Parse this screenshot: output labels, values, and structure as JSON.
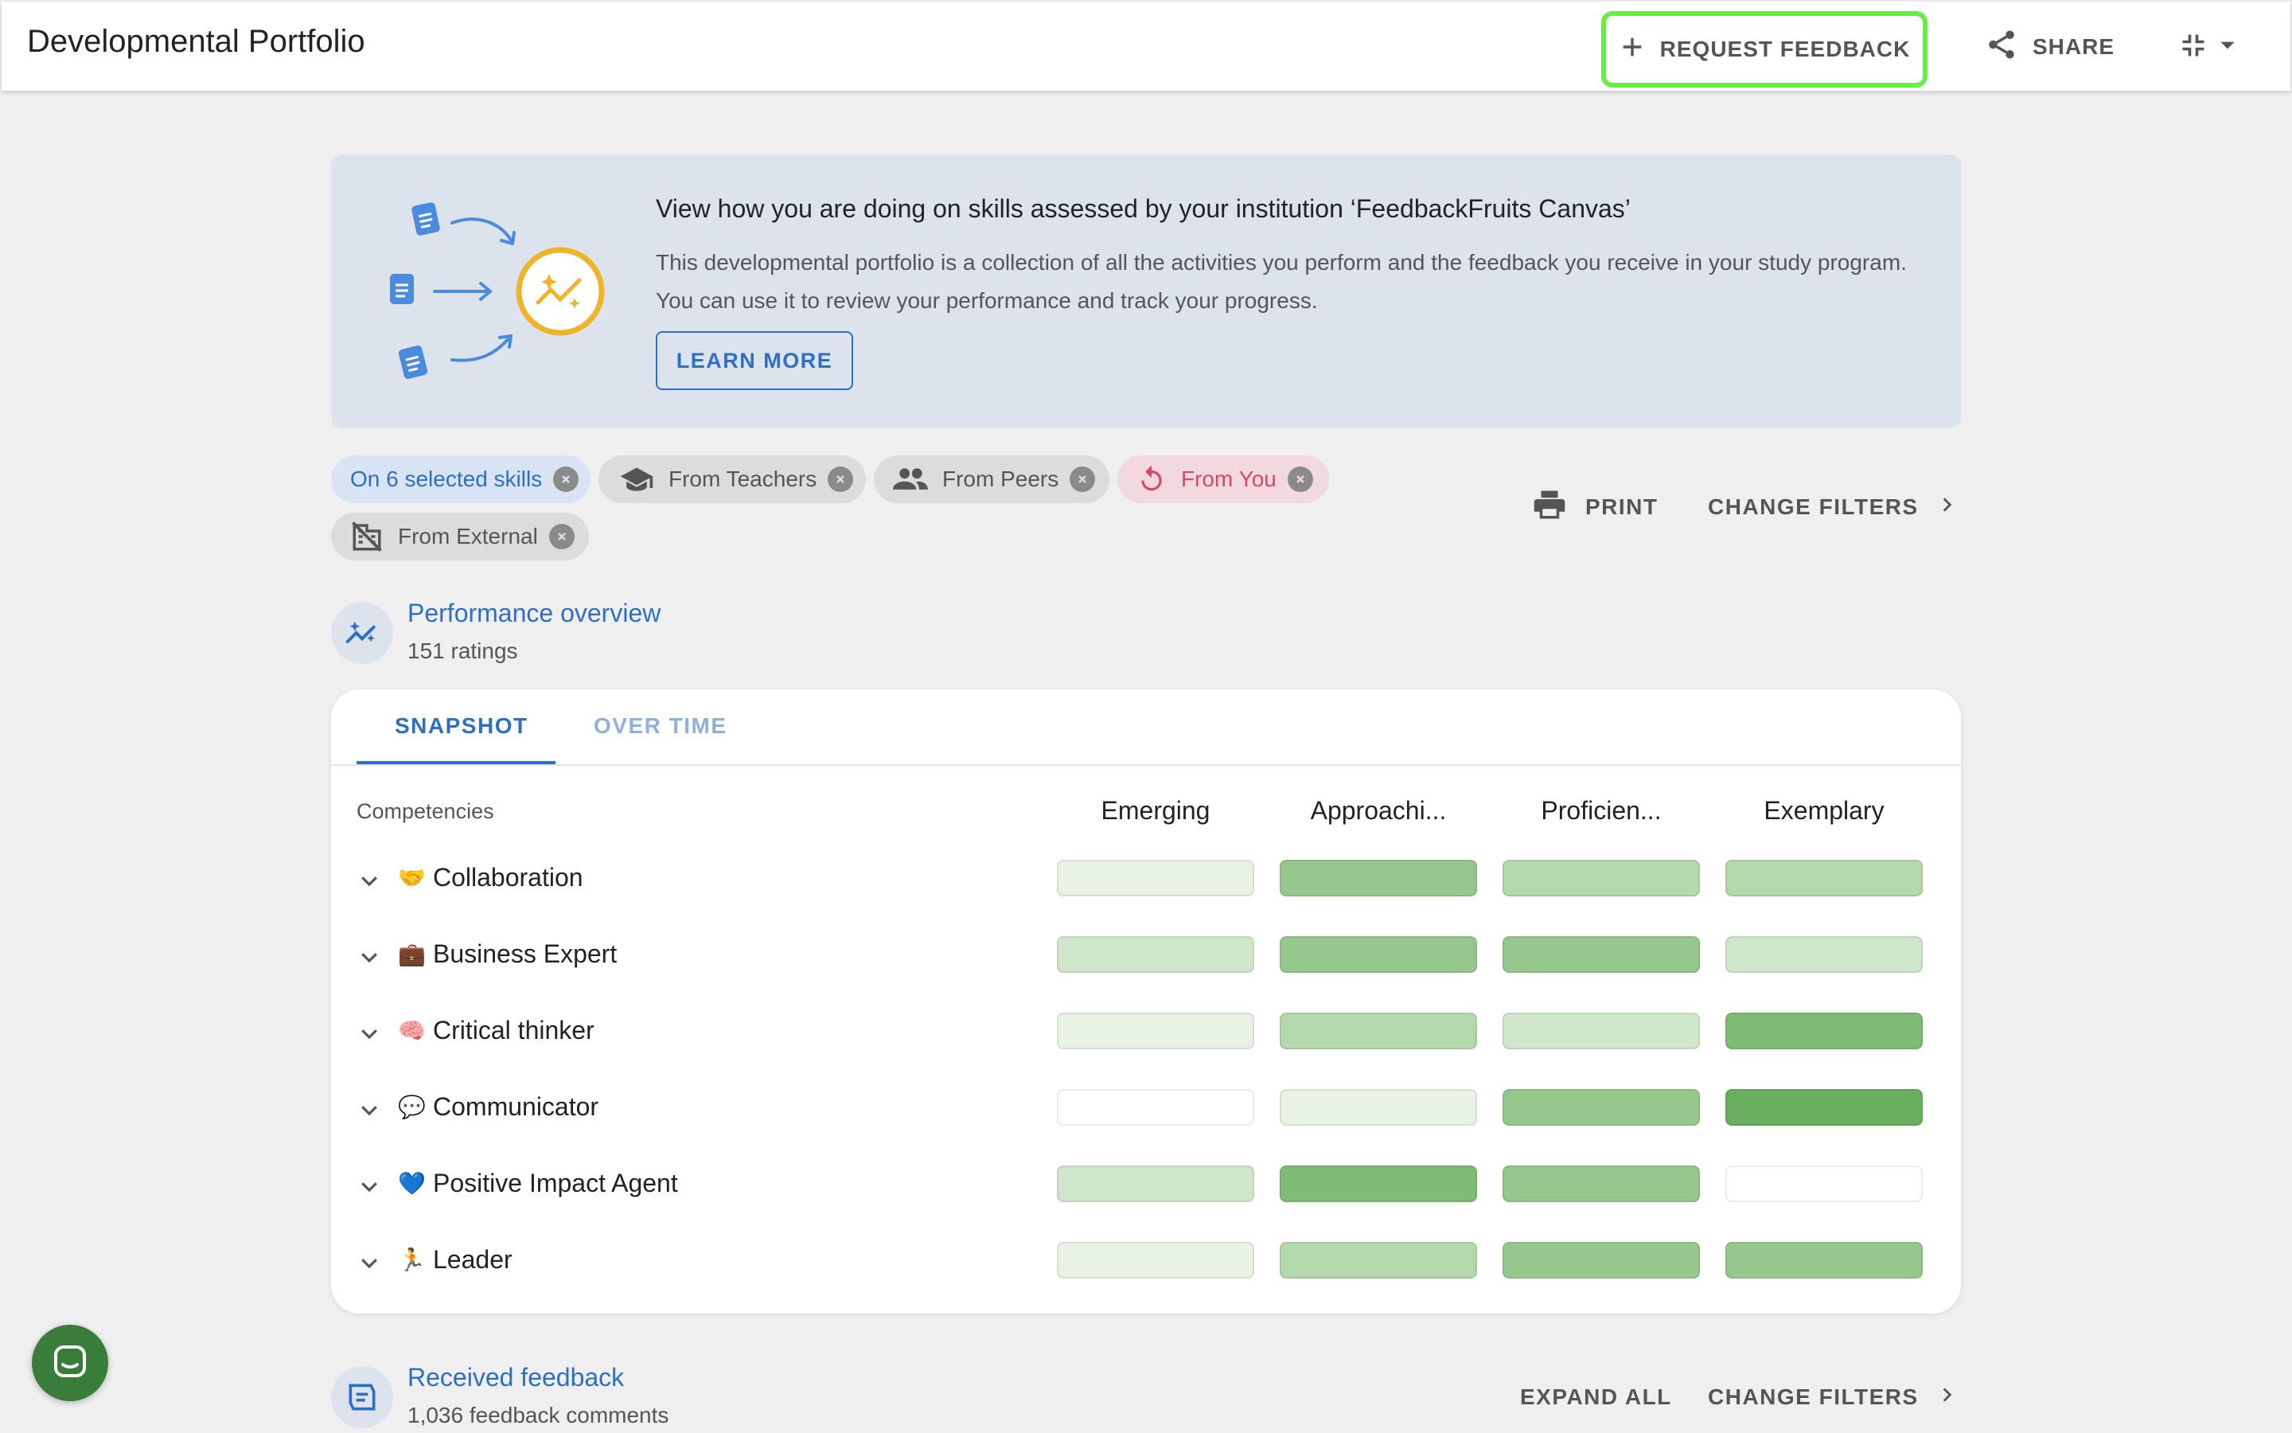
{
  "header": {
    "title": "Developmental Portfolio",
    "request_feedback": "REQUEST FEEDBACK",
    "share": "SHARE"
  },
  "banner": {
    "heading": "View how you are doing on skills assessed by your institution ‘FeedbackFruits Canvas’",
    "text": "This developmental portfolio is a collection of all the activities you perform and the feedback you receive in your study program. You can use it to review your performance and track your progress.",
    "learn_more": "LEARN MORE"
  },
  "filters": {
    "chips": [
      "On 6 selected skills",
      "From Teachers",
      "From Peers",
      "From You",
      "From External"
    ],
    "print": "PRINT",
    "change_filters": "CHANGE FILTERS"
  },
  "performance": {
    "title": "Performance overview",
    "subtitle": "151 ratings",
    "tabs": [
      "SNAPSHOT",
      "OVER TIME"
    ],
    "competencies_label": "Competencies",
    "levels": [
      "Emerging",
      "Approachi...",
      "Proficien...",
      "Exemplary"
    ],
    "rows": [
      {
        "emoji": "🤝",
        "label": "Collaboration",
        "intensity": [
          1,
          4,
          3,
          3
        ]
      },
      {
        "emoji": "💼",
        "label": "Business Expert",
        "intensity": [
          2,
          4,
          4,
          2
        ]
      },
      {
        "emoji": "🧠",
        "label": "Critical thinker",
        "intensity": [
          1,
          3,
          2,
          5
        ]
      },
      {
        "emoji": "💬",
        "label": "Communicator",
        "intensity": [
          0,
          1,
          4,
          6
        ]
      },
      {
        "emoji": "💙",
        "label": "Positive Impact Agent",
        "intensity": [
          2,
          5,
          4,
          0
        ]
      },
      {
        "emoji": "🏃",
        "label": "Leader",
        "intensity": [
          1,
          3,
          4,
          4
        ]
      }
    ],
    "palette": [
      "#ffffff",
      "#e8f3e6",
      "#cfe6cb",
      "#b3d9ad",
      "#96c88e",
      "#7fbd76",
      "#6aaf5f"
    ]
  },
  "received": {
    "title": "Received feedback",
    "subtitle": "1,036 feedback comments",
    "expand_all": "EXPAND ALL",
    "change_filters": "CHANGE FILTERS"
  },
  "icons": [
    "plus-icon",
    "share-icon",
    "collapse-icon",
    "caret-down-icon",
    "print-icon",
    "chevron-right-icon",
    "graduation-cap-icon",
    "people-icon",
    "undo-icon",
    "no-building-icon",
    "trend-icon",
    "feedback-icon",
    "chat-icon"
  ]
}
